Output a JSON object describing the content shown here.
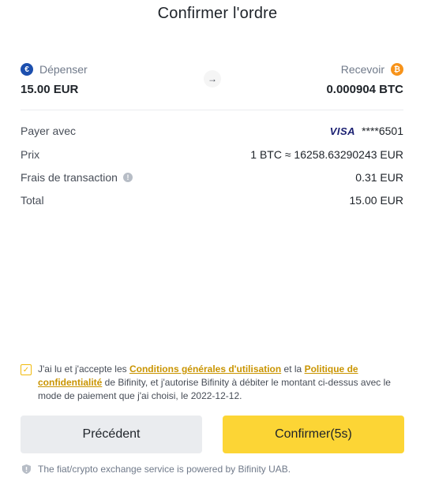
{
  "title": "Confirmer l'ordre",
  "spend": {
    "label": "Dépenser",
    "amount": "15.00 EUR",
    "currency_icon": "euro-coin-icon",
    "currency_glyph": "€"
  },
  "receive": {
    "label": "Recevoir",
    "amount": "0.000904 BTC",
    "currency_icon": "bitcoin-coin-icon",
    "currency_glyph": "₿"
  },
  "arrow_glyph": "→",
  "details": {
    "payment": {
      "label": "Payer avec",
      "brand": "VISA",
      "value": "****6501"
    },
    "price": {
      "label": "Prix",
      "value": "1 BTC ≈ 16258.63290243 EUR"
    },
    "fee": {
      "label": "Frais de transaction",
      "value": "0.31 EUR"
    },
    "total": {
      "label": "Total",
      "value": "15.00 EUR"
    }
  },
  "consent": {
    "checked": true,
    "text_1": "J'ai lu et j'accepte les ",
    "link_terms": "Conditions générales d'utilisation",
    "text_2": " et la ",
    "link_privacy": "Politique de confidentialité",
    "text_3": " de Bifinity, et j'autorise Bifinity à débiter le montant ci-dessus avec le mode de paiement que j'ai choisi, le 2022-12-12."
  },
  "buttons": {
    "previous": "Précédent",
    "confirm": "Confirmer(5s)"
  },
  "footer": "The fiat/crypto exchange service is powered by Bifinity UAB.",
  "colors": {
    "accent": "#fcd535",
    "link": "#c99400",
    "eur": "#1c4fae",
    "btc": "#f7931a"
  }
}
